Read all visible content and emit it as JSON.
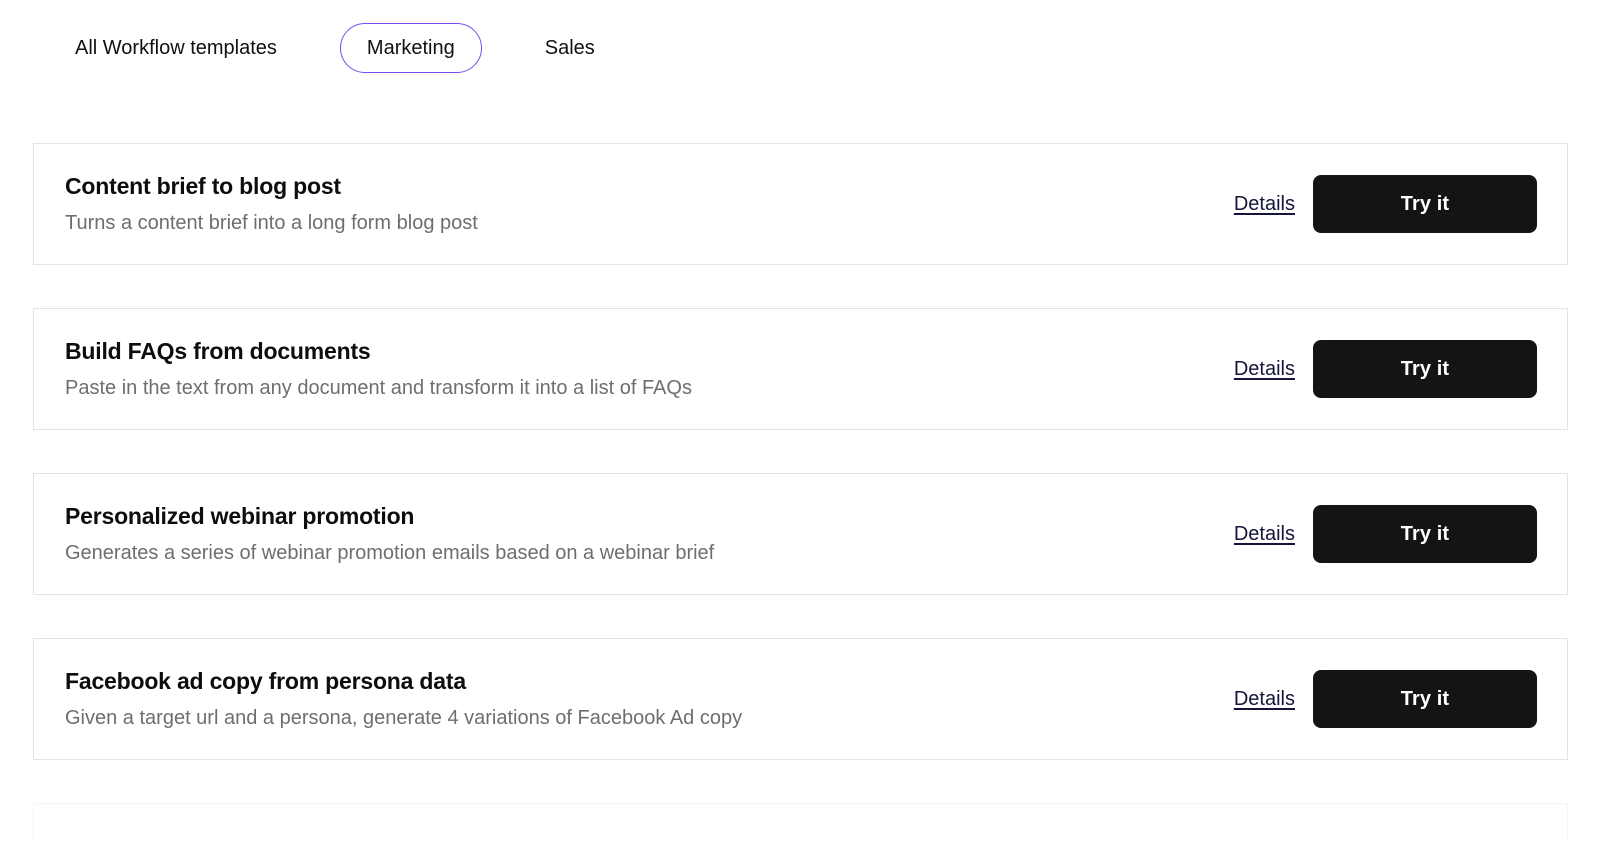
{
  "tabs": [
    {
      "label": "All Workflow templates",
      "active": false
    },
    {
      "label": "Marketing",
      "active": true
    },
    {
      "label": "Sales",
      "active": false
    }
  ],
  "colors": {
    "active_tab_border": "#7a4ef0",
    "button_background": "#141414",
    "button_text": "#ffffff",
    "card_border": "#e3e3e3",
    "title_text": "#0d0d0d",
    "description_text": "#6e6e6e",
    "link_text": "#15153a",
    "page_background": "#ffffff"
  },
  "actions": {
    "details_label": "Details",
    "try_label": "Try it"
  },
  "cards": [
    {
      "title": "Content brief to blog post",
      "description": "Turns a content brief into a long form blog post"
    },
    {
      "title": "Build FAQs from documents",
      "description": "Paste in the text from any document and transform it into a list of FAQs"
    },
    {
      "title": "Personalized webinar promotion",
      "description": "Generates a series of webinar promotion emails based on a webinar brief"
    },
    {
      "title": "Facebook ad copy from persona data",
      "description": "Given a target url and a persona, generate 4 variations of Facebook Ad copy"
    }
  ]
}
